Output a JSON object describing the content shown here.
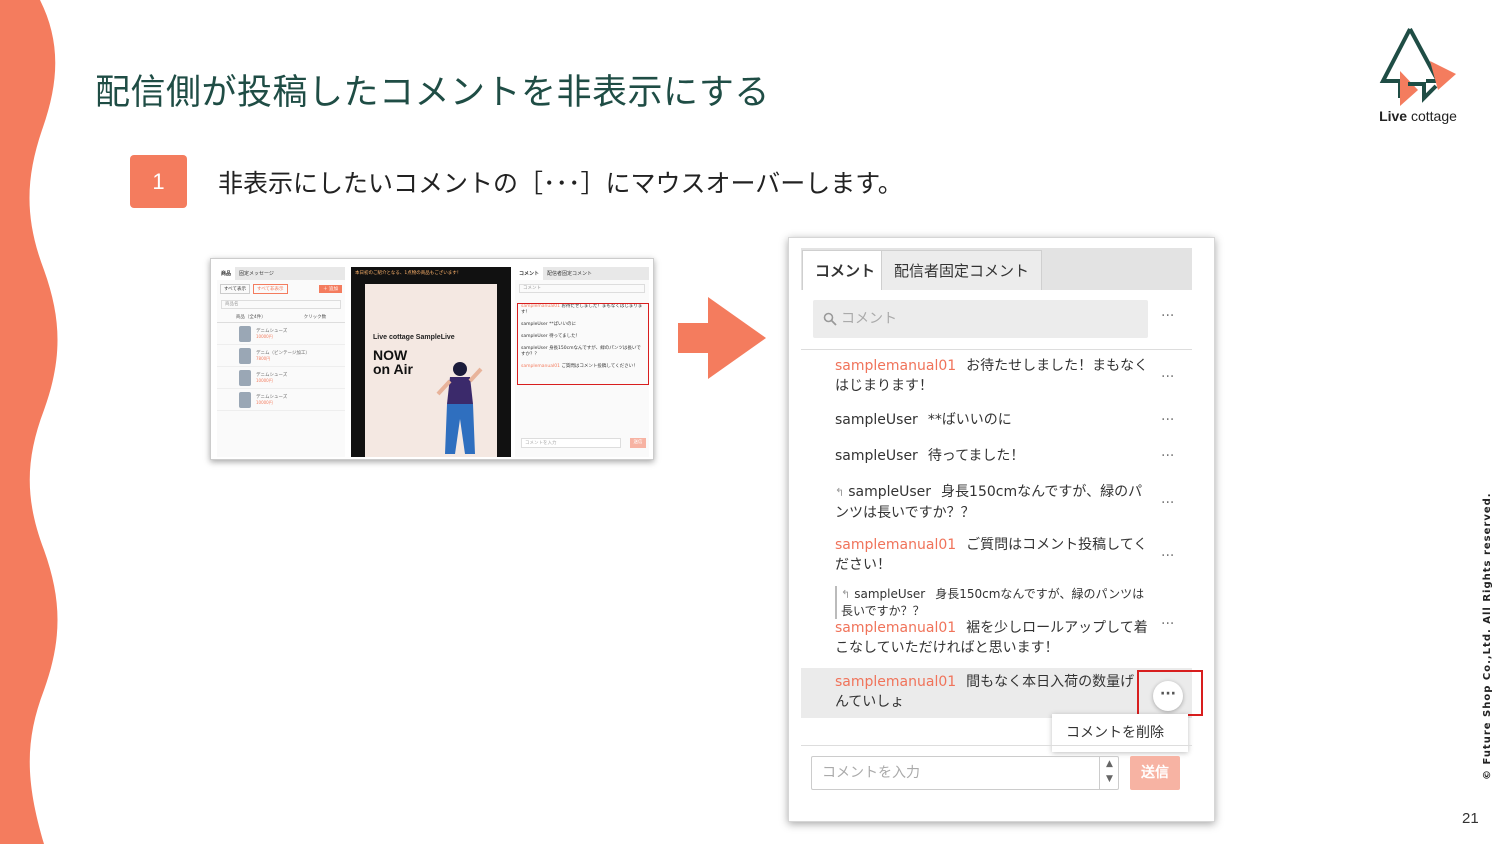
{
  "slide": {
    "title": "配信側が投稿したコメントを非表示にする",
    "step_number": "1",
    "step_text": "非表示にしたいコメントの［･･･］にマウスオーバーします。",
    "copyright": "© Future Shop Co.,Ltd. All Rights reserved.",
    "page_number": "21",
    "accent_color": "#f47c5e"
  },
  "logo": {
    "brand_bold": "Live",
    "brand_rest": " cottage"
  },
  "thumbnail": {
    "tabs": [
      "商品",
      "固定メッセージ"
    ],
    "filter_buttons": [
      "すべて表示",
      "すべて非表示"
    ],
    "add_button": "＋ 追加",
    "search_placeholder": "商品名",
    "table_headers": [
      "商品（全4件）",
      "クリック数"
    ],
    "products": [
      {
        "name": "デニムシューズ",
        "price": "10000円"
      },
      {
        "name": "デニム（ビンテージ加工）",
        "price": "7800円"
      },
      {
        "name": "デニムシューズ",
        "price": "10000円"
      },
      {
        "name": "デニムシューズ",
        "price": "10000円"
      }
    ],
    "banner": "本日初のご紹介となる、1点物の商品もございます！",
    "live_title": "Live cottage SampleLive",
    "now_on_air": "NOW on Air",
    "comment_tabs": [
      "コメント",
      "配信者固定コメント"
    ],
    "comment_search": "コメント",
    "comments": [
      {
        "user": "samplemanual01",
        "text": "お待たせしました！まもなくはじまります！"
      },
      {
        "user": "sampleUser",
        "text": "**ばいいのに"
      },
      {
        "user": "sampleUser",
        "text": "待ってました！"
      },
      {
        "user": "sampleUser",
        "text": "身長150cmなんですが、緑のパンツは長いですか？？"
      },
      {
        "user": "samplemanual01",
        "text": "ご質問はコメント投稿してください！"
      }
    ],
    "input_placeholder": "コメントを入力",
    "send_label": "送信"
  },
  "panel": {
    "tab_comment": "コメント",
    "tab_fixed": "配信者固定コメント",
    "search_placeholder": "コメント",
    "more_label": "···",
    "comments": [
      {
        "user": "samplemanual01",
        "text": "お待たせしました！まもなくはじまります！"
      },
      {
        "user": "sampleUser",
        "text": "**ばいいのに"
      },
      {
        "user": "sampleUser",
        "text": "待ってました！"
      },
      {
        "user": "sampleUser",
        "text": "身長150cmなんですが、緑のパンツは長いですか？？"
      },
      {
        "user": "samplemanual01",
        "text": "ご質問はコメント投稿してください！"
      },
      {
        "quote_user": "sampleUser",
        "quote_text": "身長150cmなんですが、緑のパンツは長いですか？？",
        "user": "samplemanual01",
        "text": "裾を少しロールアップして着こなしていただければと思います！"
      },
      {
        "user": "samplemanual01",
        "text": "間もなく本日入荷の数量げんていしょ"
      }
    ],
    "delete_menu": "コメントを削除",
    "input_placeholder": "コメントを入力",
    "send_label": "送信"
  }
}
